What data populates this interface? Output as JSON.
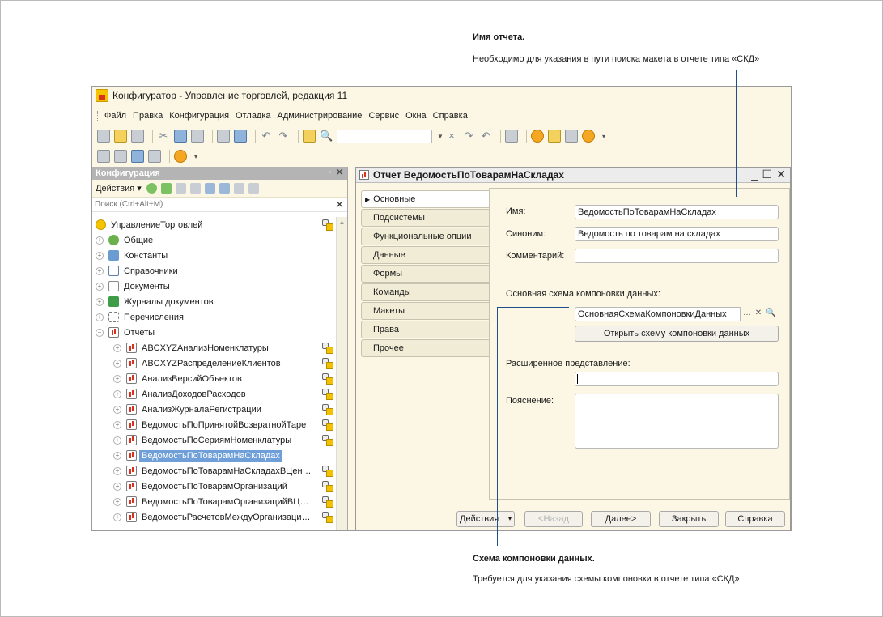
{
  "annotations": {
    "top_title": "Имя отчета.",
    "top_text": "Необходимо для указания в пути поиска макета в отчете типа «СКД»",
    "bottom_title": "Схема компоновки данных.",
    "bottom_text": "Требуется для указания схемы компоновки в отчете типа «СКД»"
  },
  "window": {
    "title": "Конфигуратор - Управление торговлей, редакция 11",
    "menu": [
      "Файл",
      "Правка",
      "Конфигурация",
      "Отладка",
      "Администрирование",
      "Сервис",
      "Окна",
      "Справка"
    ],
    "toolbar_icons": [
      "new-icon",
      "open-icon",
      "save-icon",
      "cut-icon",
      "copy-icon",
      "paste-icon",
      "print-icon",
      "preview-icon",
      "undo-icon",
      "redo-icon",
      "find-icon",
      "find-in-tree-icon",
      "search-combo",
      "find-next-icon",
      "find-prev-icon",
      "window-icon",
      "wizard-icon",
      "help-search-icon",
      "help-book-icon",
      "info-icon"
    ]
  },
  "left_panel": {
    "title": "Конфигурация",
    "actions_label": "Действия",
    "search_placeholder": "Поиск (Ctrl+Alt+M)",
    "tree": [
      {
        "label": "УправлениеТорговлей",
        "kind": "root",
        "level": 0,
        "lock": true
      },
      {
        "label": "Общие",
        "kind": "general",
        "level": 0,
        "expander": "+"
      },
      {
        "label": "Константы",
        "kind": "const",
        "level": 0,
        "expander": "+"
      },
      {
        "label": "Справочники",
        "kind": "ref",
        "level": 0,
        "expander": "+"
      },
      {
        "label": "Документы",
        "kind": "doc",
        "level": 0,
        "expander": "+"
      },
      {
        "label": "Журналы документов",
        "kind": "journal",
        "level": 0,
        "expander": "+"
      },
      {
        "label": "Перечисления",
        "kind": "enum",
        "level": 0,
        "expander": "+"
      },
      {
        "label": "Отчеты",
        "kind": "report",
        "level": 0,
        "expander": "−"
      },
      {
        "label": "ABCXYZАнализНоменклатуры",
        "kind": "report",
        "level": 1,
        "expander": "+",
        "lock": true
      },
      {
        "label": "ABCXYZРаспределениеКлиентов",
        "kind": "report",
        "level": 1,
        "expander": "+",
        "lock": true
      },
      {
        "label": "АнализВерсийОбъектов",
        "kind": "report",
        "level": 1,
        "expander": "+",
        "lock": true
      },
      {
        "label": "АнализДоходовРасходов",
        "kind": "report",
        "level": 1,
        "expander": "+",
        "lock": true
      },
      {
        "label": "АнализЖурналаРегистрации",
        "kind": "report",
        "level": 1,
        "expander": "+",
        "lock": true
      },
      {
        "label": "ВедомостьПоПринятойВозвратнойТаре",
        "kind": "report",
        "level": 1,
        "expander": "+",
        "lock": true
      },
      {
        "label": "ВедомостьПоСериямНоменклатуры",
        "kind": "report",
        "level": 1,
        "expander": "+",
        "lock": true
      },
      {
        "label": "ВедомостьПоТоварамНаСкладах",
        "kind": "report",
        "level": 1,
        "expander": "+",
        "selected": true
      },
      {
        "label": "ВедомостьПоТоварамНаСкладахВЦен…",
        "kind": "report",
        "level": 1,
        "expander": "+",
        "lock": true
      },
      {
        "label": "ВедомостьПоТоварамОрганизаций",
        "kind": "report",
        "level": 1,
        "expander": "+",
        "lock": true
      },
      {
        "label": "ВедомостьПоТоварамОрганизацийВЦ…",
        "kind": "report",
        "level": 1,
        "expander": "+",
        "lock": true
      },
      {
        "label": "ВедомостьРасчетовМеждуОрганизаци…",
        "kind": "report",
        "level": 1,
        "expander": "+",
        "lock": true
      }
    ]
  },
  "dialog": {
    "title": "Отчет ВедомостьПоТоварамНаСкладах",
    "tabs": [
      "Основные",
      "Подсистемы",
      "Функциональные опции",
      "Данные",
      "Формы",
      "Команды",
      "Макеты",
      "Права",
      "Прочее"
    ],
    "fields": {
      "name_label": "Имя:",
      "name_value": "ВедомостьПоТоварамНаСкладах",
      "synonym_label": "Синоним:",
      "synonym_value": "Ведомость по товарам на складах",
      "comment_label": "Комментарий:",
      "comment_value": "",
      "dcs_label": "Основная схема компоновки данных:",
      "dcs_value": "ОсновнаяСхемаКомпоновкиДанных",
      "open_dcs_button": "Открыть схему компоновки данных",
      "ext_label": "Расширенное представление:",
      "ext_value": "",
      "note_label": "Пояснение:",
      "note_value": ""
    },
    "buttons": {
      "actions": "Действия",
      "back": "<Назад",
      "next": "Далее>",
      "close": "Закрыть",
      "help": "Справка"
    }
  }
}
